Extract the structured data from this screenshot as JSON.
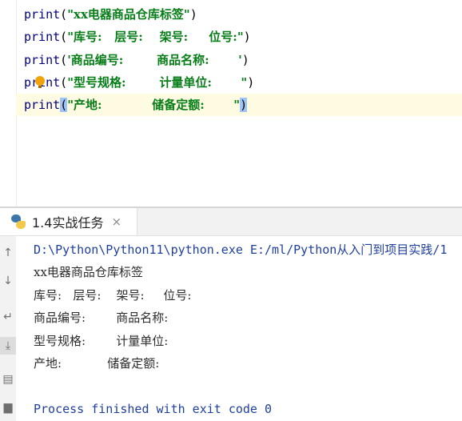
{
  "editor": {
    "lines": [
      {
        "fn": "print",
        "text": "\"xx电器商品仓库标签\""
      },
      {
        "fn": "print",
        "text": "\"库号:   层号:    架号:     位号:\""
      },
      {
        "fn": "print",
        "text": "'商品编号:        商品名称:       '"
      },
      {
        "fn": "print",
        "text": "\"型号规格:        计量单位:       \""
      },
      {
        "fn": "print",
        "text": "\"产地:            储备定额:       \""
      }
    ],
    "open_paren": "(",
    "close_paren": ")",
    "intention_icon": "lightbulb-icon"
  },
  "run_panel": {
    "tab_label": "1.4实战任务",
    "tab_close": "×",
    "tab_icon": "python-icon",
    "tools": [
      "up-arrow-icon",
      "down-arrow-icon",
      "wrap-icon",
      "scroll-to-end-icon",
      "print-icon",
      "trash-icon"
    ],
    "tool_glyphs": [
      "↑",
      "↓",
      "↵",
      "⤓",
      "▤",
      "▆"
    ],
    "console_lines": [
      "D:\\Python\\Python11\\python.exe E:/ml/Python从入门到项目实践/1",
      "xx电器商品仓库标签",
      "库号:   层号:    架号:     位号:",
      "商品编号:        商品名称:",
      "型号规格:        计量单位:",
      "产地:            储备定额:",
      "",
      "Process finished with exit code 0"
    ]
  }
}
